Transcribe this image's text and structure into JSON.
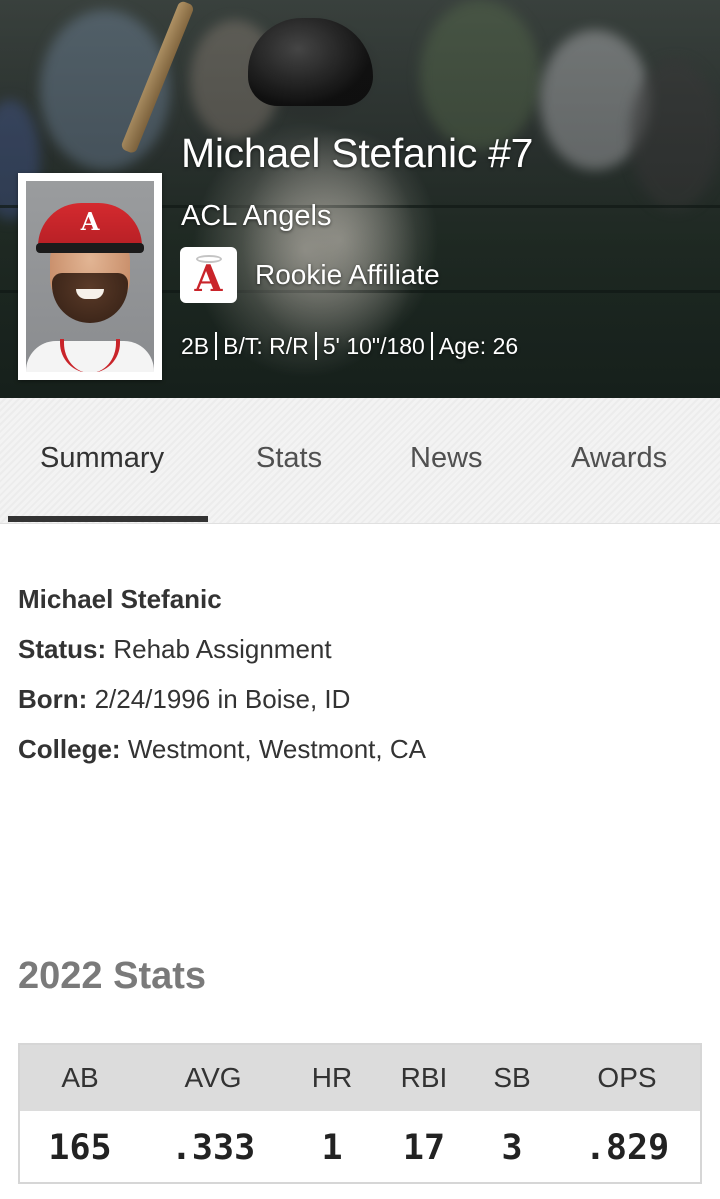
{
  "header": {
    "player_name": "Michael Stefanic #7",
    "team": "ACL Angels",
    "affiliate": "Rookie Affiliate",
    "position": "2B",
    "bats_throws": "B/T: R/R",
    "height_weight": "5' 10\"/180",
    "age": "Age: 26",
    "accent_color": "#c9242a"
  },
  "tabs": [
    {
      "label": "Summary",
      "active": true
    },
    {
      "label": "Stats",
      "active": false
    },
    {
      "label": "News",
      "active": false
    },
    {
      "label": "Awards",
      "active": false
    }
  ],
  "info": {
    "name": "Michael Stefanic",
    "status_label": "Status:",
    "status_value": "Rehab Assignment",
    "born_label": "Born:",
    "born_value": "2/24/1996 in Boise, ID",
    "college_label": "College:",
    "college_value": "Westmont, Westmont, CA"
  },
  "season_stats": {
    "title": "2022 Stats",
    "headers": [
      "AB",
      "AVG",
      "HR",
      "RBI",
      "SB",
      "OPS"
    ],
    "values": [
      "165",
      ".333",
      "1",
      "17",
      "3",
      ".829"
    ]
  }
}
